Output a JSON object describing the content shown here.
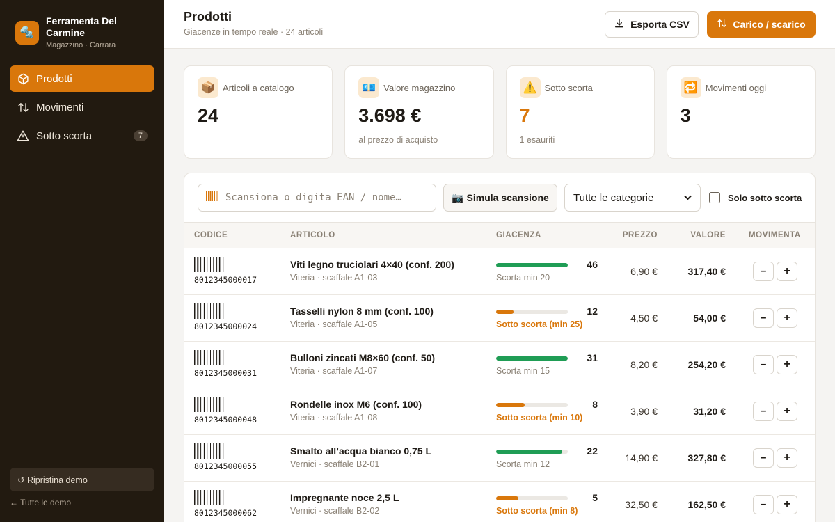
{
  "brand": {
    "name": "Ferramenta Del Carmine",
    "subtitle": "Magazzino · Carrara",
    "logo_icon": "wrench-bolt-icon"
  },
  "sidebar": {
    "items": [
      {
        "label": "Prodotti",
        "icon": "box-icon",
        "active": true
      },
      {
        "label": "Movimenti",
        "icon": "arrows-up-down-icon",
        "active": false
      },
      {
        "label": "Sotto scorta",
        "icon": "warning-triangle-icon",
        "active": false,
        "badge": "7"
      }
    ],
    "reset_label": "↺ Ripristina demo",
    "all_demos_label": "← Tutte le demo"
  },
  "header": {
    "title": "Prodotti",
    "subtitle": "Giacenze in tempo reale · 24 articoli",
    "export_label": "Esporta CSV",
    "move_label": "Carico / scarico"
  },
  "kpis": [
    {
      "label": "Articoli a catalogo",
      "value": "24",
      "note": "",
      "icon": "📦"
    },
    {
      "label": "Valore magazzino",
      "value": "3.698 €",
      "note": "al prezzo di acquisto",
      "icon": "💶"
    },
    {
      "label": "Sotto scorta",
      "value": "7",
      "note": "1 esauriti",
      "icon": "⚠️"
    },
    {
      "label": "Movimenti oggi",
      "value": "3",
      "note": "",
      "icon": "🔁"
    }
  ],
  "toolbar": {
    "scan_placeholder": "Scansiona o digita EAN / nome…",
    "simulate_label": "📷 Simula scansione",
    "category_selected": "Tutte le categorie",
    "only_low_label": "Solo sotto scorta"
  },
  "table": {
    "headers": {
      "code": "CODICE",
      "article": "ARTICOLO",
      "stock": "GIACENZA",
      "price": "PREZZO",
      "value": "VALORE",
      "move": "MOVIMENTA"
    },
    "minus_label": "–",
    "plus_label": "+",
    "rows": [
      {
        "code": "8012345000017",
        "name": "Viti legno truciolari 4×40 (conf. 200)",
        "sub": "Viteria · scaffale A1-03",
        "qty": "46",
        "level": 1.0,
        "low": false,
        "stock_note": "Scorta min 20",
        "price": "6,90 €",
        "value": "317,40 €"
      },
      {
        "code": "8012345000024",
        "name": "Tasselli nylon 8 mm (conf. 100)",
        "sub": "Viteria · scaffale A1-05",
        "qty": "12",
        "level": 0.24,
        "low": true,
        "stock_note": "Sotto scorta (min 25)",
        "price": "4,50 €",
        "value": "54,00 €"
      },
      {
        "code": "8012345000031",
        "name": "Bulloni zincati M8×60 (conf. 50)",
        "sub": "Viteria · scaffale A1-07",
        "qty": "31",
        "level": 1.0,
        "low": false,
        "stock_note": "Scorta min 15",
        "price": "8,20 €",
        "value": "254,20 €"
      },
      {
        "code": "8012345000048",
        "name": "Rondelle inox M6 (conf. 100)",
        "sub": "Viteria · scaffale A1-08",
        "qty": "8",
        "level": 0.4,
        "low": true,
        "stock_note": "Sotto scorta (min 10)",
        "price": "3,90 €",
        "value": "31,20 €"
      },
      {
        "code": "8012345000055",
        "name": "Smalto all’acqua bianco 0,75 L",
        "sub": "Vernici · scaffale B2-01",
        "qty": "22",
        "level": 0.92,
        "low": false,
        "stock_note": "Scorta min 12",
        "price": "14,90 €",
        "value": "327,80 €"
      },
      {
        "code": "8012345000062",
        "name": "Impregnante noce 2,5 L",
        "sub": "Vernici · scaffale B2-02",
        "qty": "5",
        "level": 0.31,
        "low": true,
        "stock_note": "Sotto scorta (min 8)",
        "price": "32,50 €",
        "value": "162,50 €"
      }
    ]
  },
  "colors": {
    "accent": "#d9770b",
    "ok": "#1f9d55",
    "sidebar_bg": "#221a10"
  }
}
